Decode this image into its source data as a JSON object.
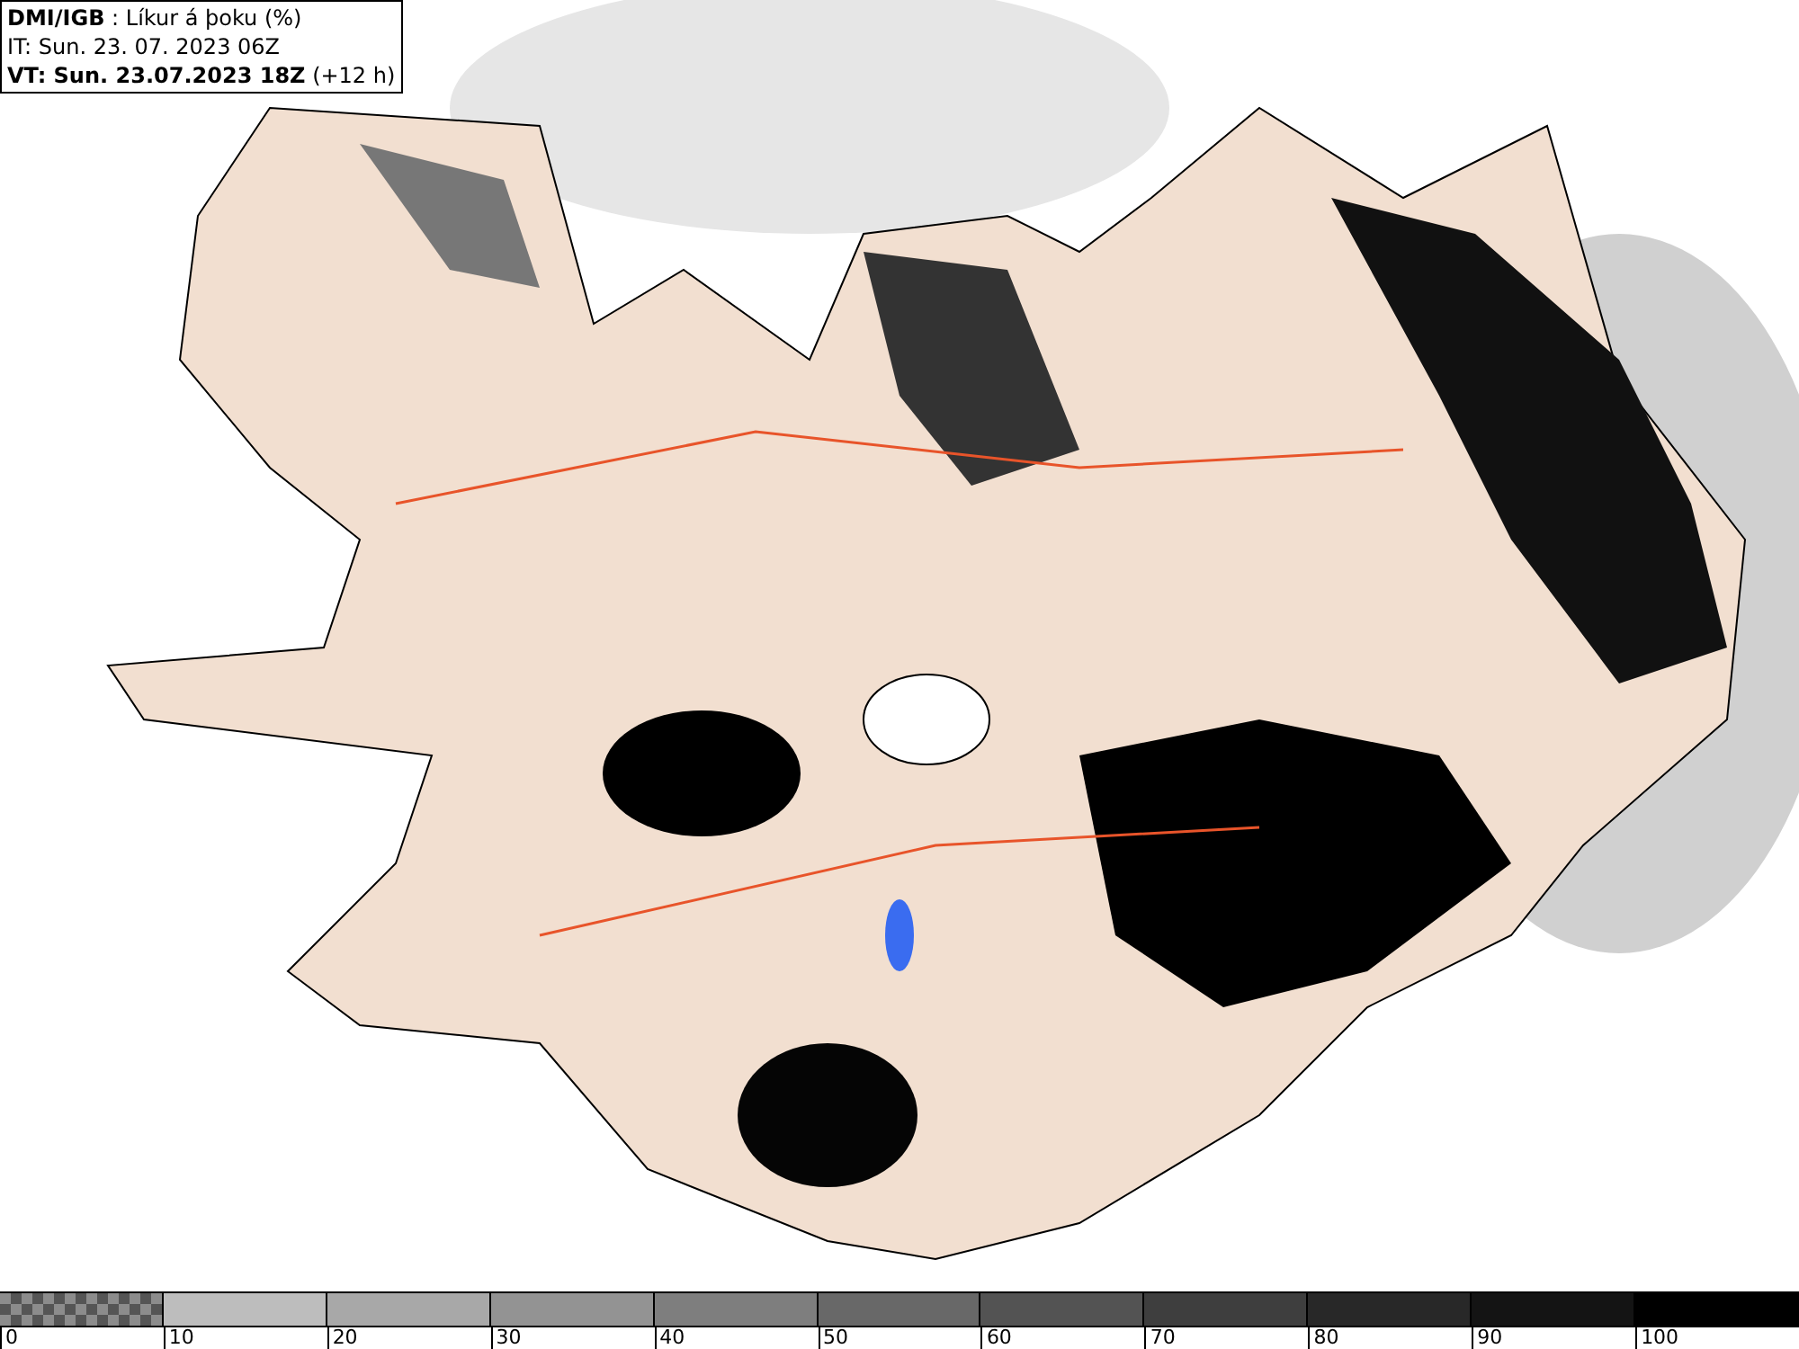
{
  "header": {
    "lines": [
      "**DMI/IGB** : Líkur á þoku (%)",
      "IT: Sun. 23. 07. 2023 06Z",
      "**VT: Sun. 23.07.2023 18Z** (+12 h)"
    ]
  },
  "legend": {
    "bins": [
      {
        "label": "0",
        "kind": "checker"
      },
      {
        "label": "10",
        "kind": "solid",
        "color": "#bdbdbd"
      },
      {
        "label": "20",
        "kind": "solid",
        "color": "#a8a8a8"
      },
      {
        "label": "30",
        "kind": "solid",
        "color": "#939393"
      },
      {
        "label": "40",
        "kind": "solid",
        "color": "#7e7e7e"
      },
      {
        "label": "50",
        "kind": "solid",
        "color": "#686868"
      },
      {
        "label": "60",
        "kind": "solid",
        "color": "#535353"
      },
      {
        "label": "70",
        "kind": "solid",
        "color": "#3e3e3e"
      },
      {
        "label": "80",
        "kind": "solid",
        "color": "#282828"
      },
      {
        "label": "90",
        "kind": "solid",
        "color": "#141414"
      },
      {
        "label": "100",
        "kind": "solid",
        "color": "#000000"
      }
    ]
  }
}
